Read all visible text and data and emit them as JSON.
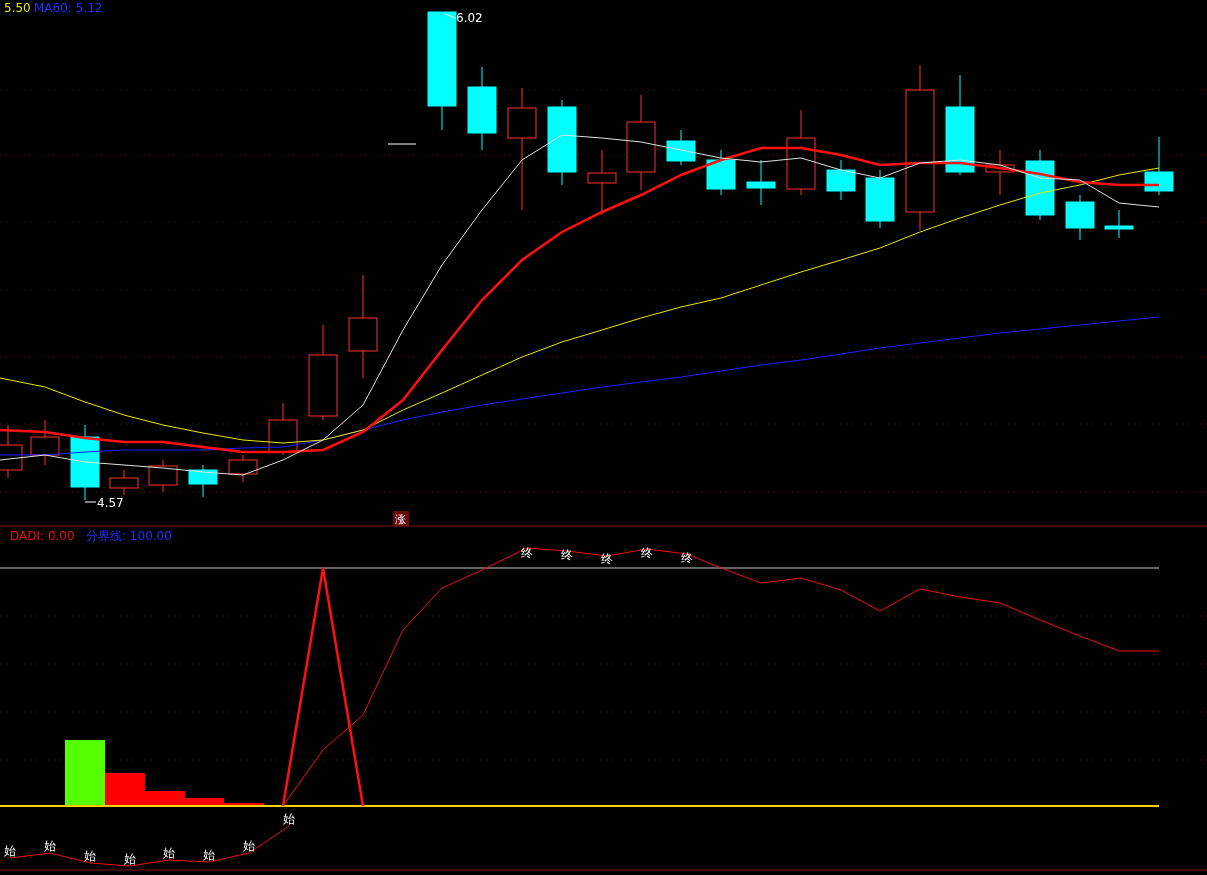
{
  "price_panel": {
    "legend": [
      "5.50",
      "MA60: 5.12"
    ],
    "high_label": "6.02",
    "low_label": "4.57",
    "signal_mark": "涨"
  },
  "indicator_panel": {
    "legend": [
      "DADI: 0.00",
      "分界线: 100.00"
    ],
    "end_marks": [
      "终",
      "终",
      "终",
      "终",
      "终"
    ],
    "start_marks": [
      "始",
      "始",
      "始",
      "始",
      "始",
      "始",
      "始",
      "始"
    ]
  }
}
